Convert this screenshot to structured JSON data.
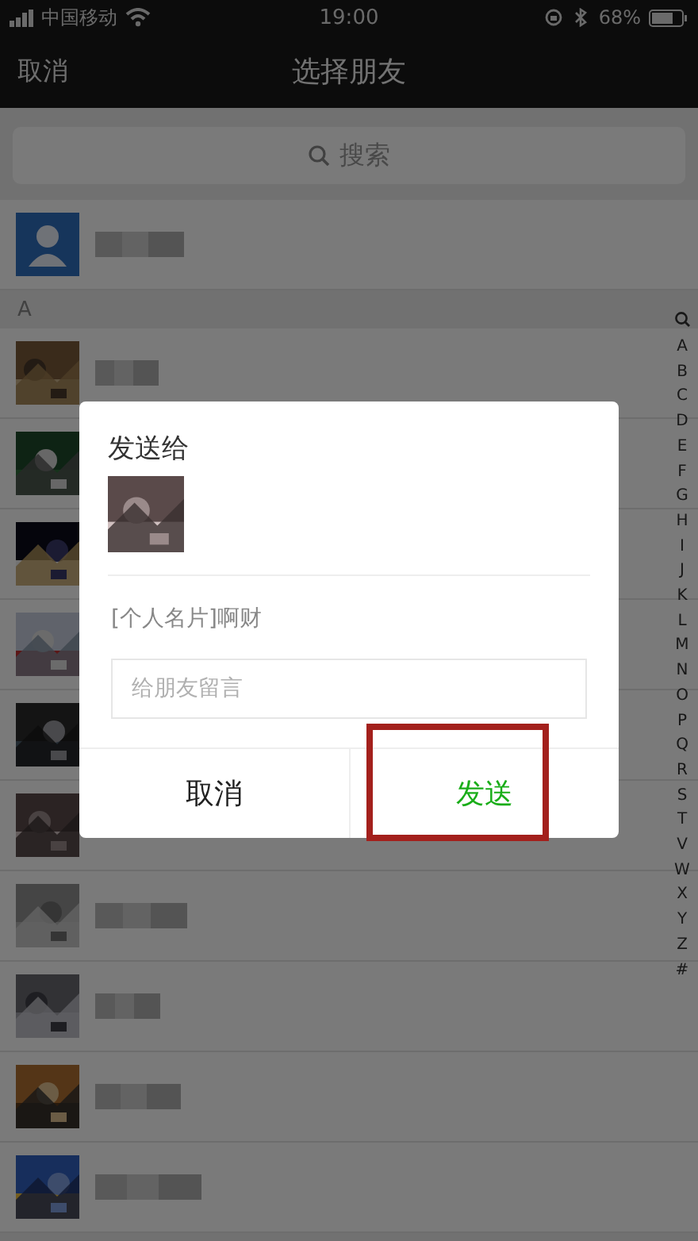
{
  "status_bar": {
    "carrier": "中国移动",
    "time": "19:00",
    "battery": "68%"
  },
  "nav": {
    "cancel": "取消",
    "title": "选择朋友"
  },
  "search": {
    "placeholder": "搜索"
  },
  "top_contact": {
    "kind": "default_avatar"
  },
  "sections": [
    {
      "letter": "A"
    }
  ],
  "index": [
    "A",
    "B",
    "C",
    "D",
    "E",
    "F",
    "G",
    "H",
    "I",
    "J",
    "K",
    "L",
    "M",
    "N",
    "O",
    "P",
    "Q",
    "R",
    "S",
    "T",
    "V",
    "W",
    "X",
    "Y",
    "Z",
    "#"
  ],
  "dialog": {
    "title": "发送给",
    "card_text": "[个人名片]啊财",
    "message": {
      "placeholder": "给朋友留言"
    },
    "buttons": [
      {
        "label": "取消",
        "kind": "cancel",
        "highlighted": false
      },
      {
        "label": "发送",
        "kind": "confirm",
        "highlighted": true
      }
    ]
  }
}
